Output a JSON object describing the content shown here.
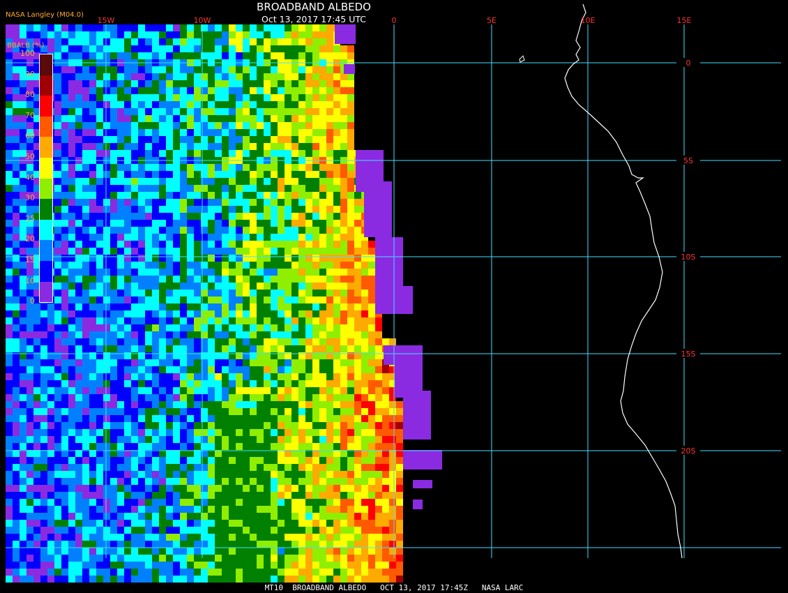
{
  "header": {
    "title": "BROADBAND ALBEDO",
    "subtitle": "Oct 13, 2017 17:45 UTC",
    "brand": "NASA Langley (M04.0)"
  },
  "footer": "MT10  BROADBAND ALBEDO   OCT 13, 2017 17:45Z   NASA LARC",
  "legend": {
    "title": "BBALB (%)",
    "labels": [
      "100",
      "90",
      "80",
      "70",
      "60",
      "50",
      "40",
      "30",
      "25",
      "20",
      "15",
      "10",
      "0"
    ],
    "colors": [
      "#5a0a0a",
      "#a00000",
      "#ff0000",
      "#ff5a00",
      "#ffaa00",
      "#ffff00",
      "#90ee00",
      "#008000",
      "#00ffff",
      "#0080ff",
      "#0000ff",
      "#8a2be2"
    ]
  },
  "map": {
    "lon_labels": [
      "15W",
      "10W",
      "0",
      "5E",
      "10E",
      "15E"
    ],
    "lat_labels": [
      "0",
      "5S",
      "10S",
      "15S",
      "20S"
    ],
    "grid_color": "#40e0ff",
    "coast_color": "#ffffff"
  }
}
